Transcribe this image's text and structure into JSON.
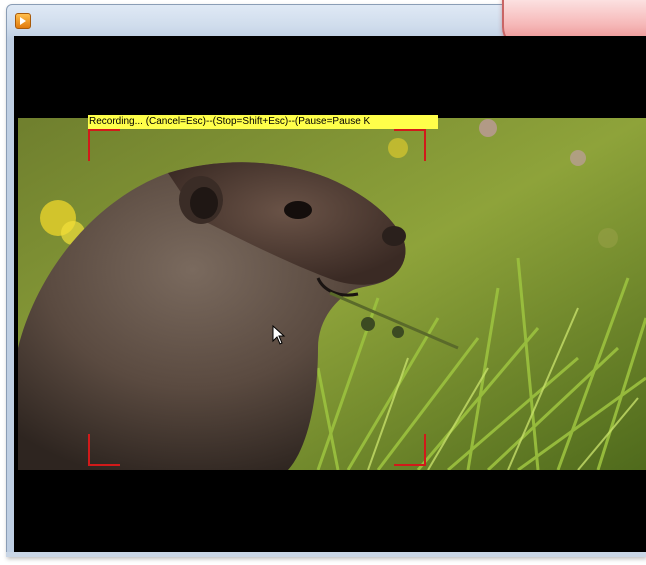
{
  "recording_bar": {
    "status_text": "Recording... (Cancel=Esc)--(Stop=Shift+Esc)--(Pause=Pause K"
  },
  "window": {
    "icon": "app-icon",
    "close_button_icon": "close-icon"
  },
  "viewer": {
    "image": "marmot-in-grass-photo",
    "cursor": "mouse-pointer-icon",
    "selection_frame_color": "#d11a1a",
    "banner_color": "#ffff4a"
  }
}
